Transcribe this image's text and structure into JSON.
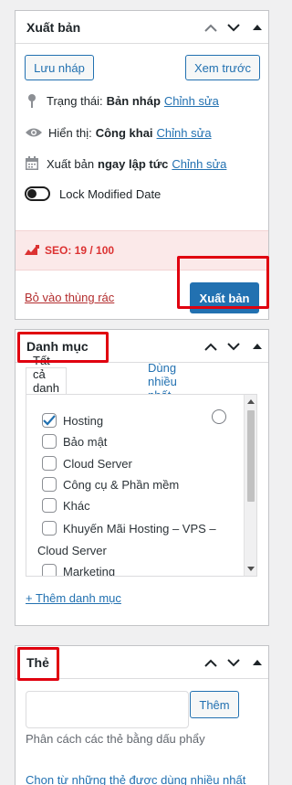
{
  "publish": {
    "title": "Xuất bản",
    "save_draft": "Lưu nháp",
    "preview": "Xem trước",
    "status_label": "Trạng thái:",
    "status_value": "Bản nháp",
    "visibility_label": "Hiển thị:",
    "visibility_value": "Công khai",
    "schedule_label": "Xuất bản",
    "schedule_value": "ngay lập tức",
    "edit_link": "Chỉnh sửa",
    "lock_modified": "Lock Modified Date",
    "seo": "SEO: 19 / 100",
    "trash": "Bỏ vào thùng rác",
    "publish_button": "Xuất bản"
  },
  "categories": {
    "title": "Danh mục",
    "tab_all": "Tất cả danh mục",
    "tab_popular": "Dùng nhiều nhất",
    "items": [
      {
        "label": "Hosting",
        "checked": true
      },
      {
        "label": "Bảo mật",
        "checked": false
      },
      {
        "label": "Cloud Server",
        "checked": false
      },
      {
        "label": "Công cụ & Phần mềm",
        "checked": false
      },
      {
        "label": "Khác",
        "checked": false
      },
      {
        "label": "Khuyến Mãi Hosting – VPS –",
        "continued": "Cloud Server",
        "checked": false
      },
      {
        "label": "Marketing",
        "checked": false
      }
    ],
    "add_new": "+ Thêm danh mục"
  },
  "tags": {
    "title": "Thẻ",
    "add_button": "Thêm",
    "input_value": "",
    "help": "Phân cách các thẻ bằng dấu phẩy",
    "choose_popular": "Chọn từ những thẻ được dùng nhiều nhất"
  },
  "colors": {
    "accent": "#2271b1",
    "seo_red": "#dc3232",
    "highlight": "#e0000f"
  }
}
